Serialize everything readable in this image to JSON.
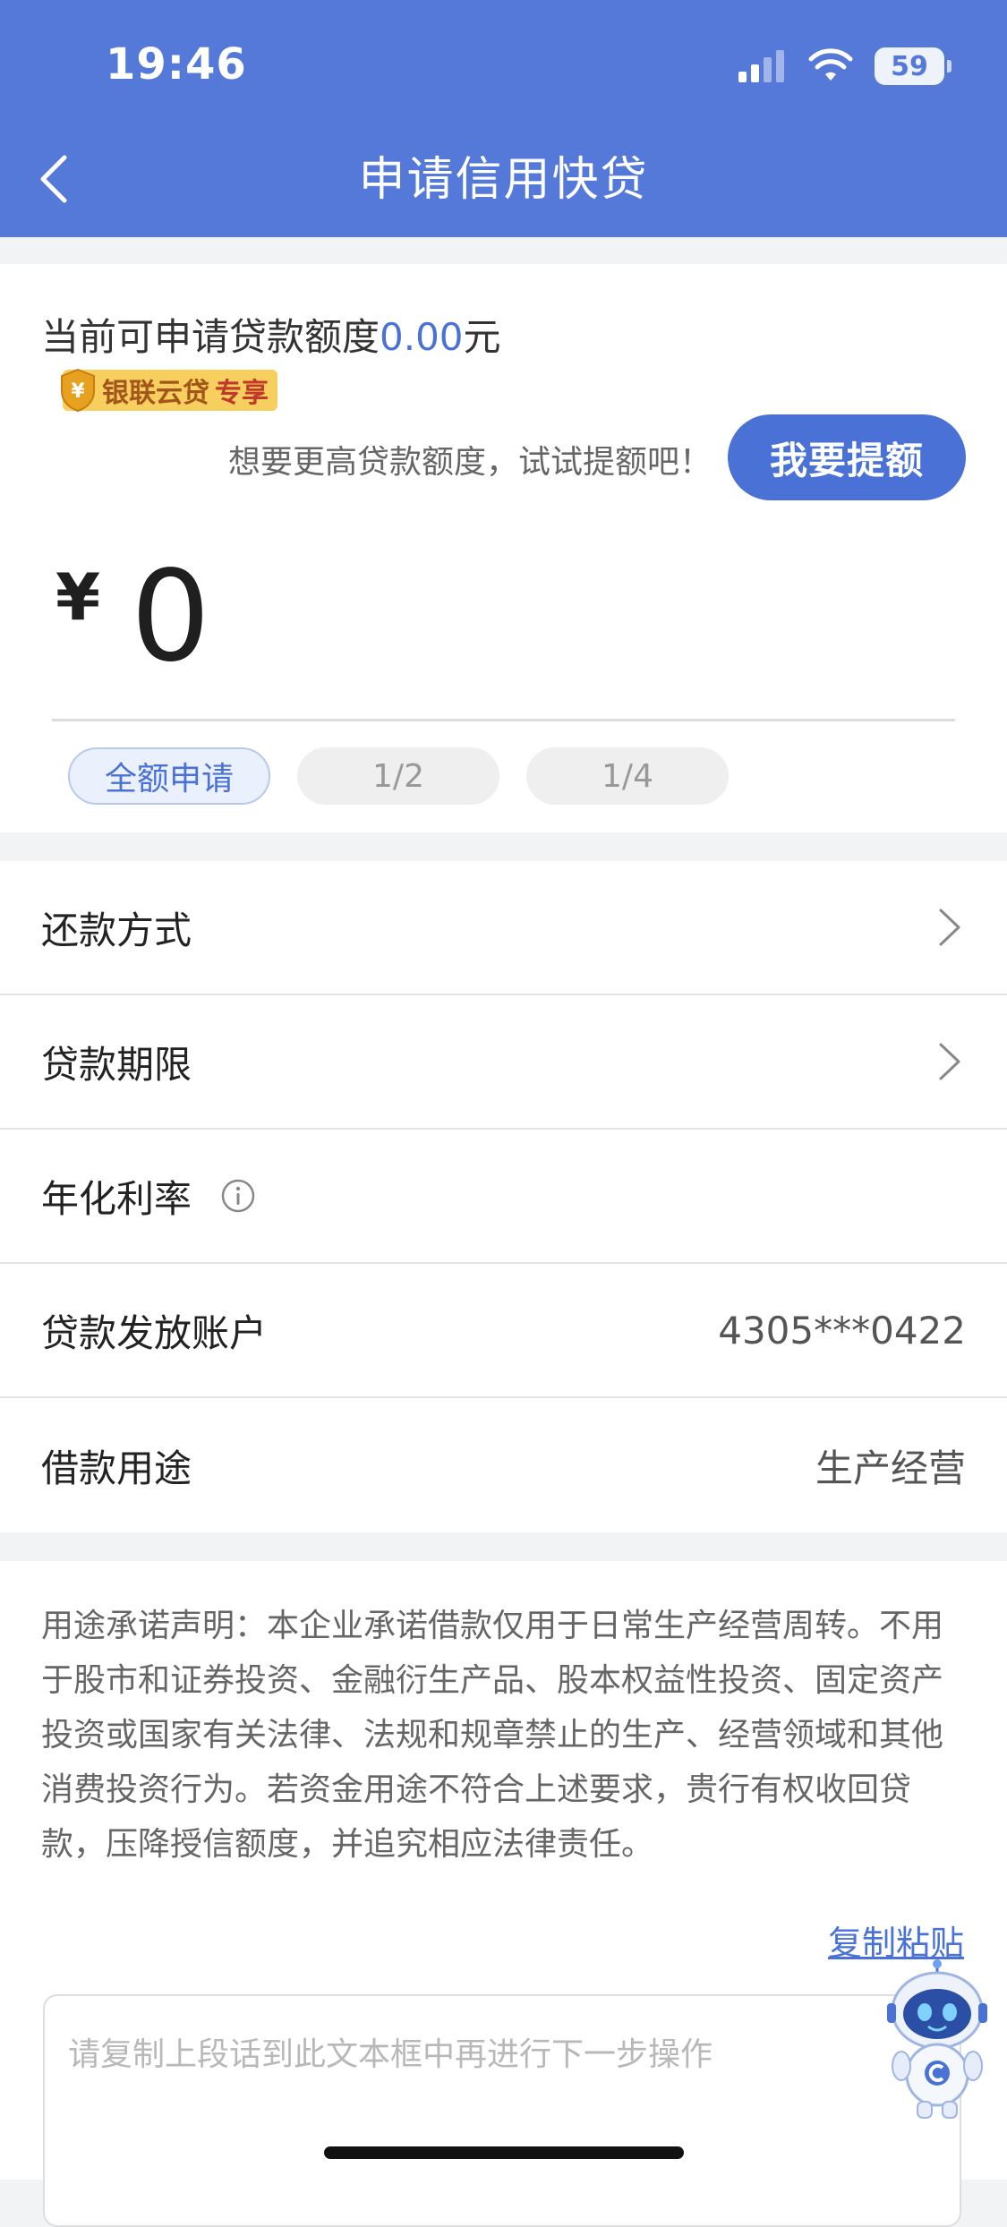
{
  "status_bar": {
    "time": "19:46",
    "battery": "59"
  },
  "nav": {
    "title": "申请信用快贷"
  },
  "quota": {
    "prefix": "当前可申请贷款额度",
    "amount": "0.00",
    "unit": "元",
    "badge_main": "银联云贷",
    "badge_sub": "专享",
    "hint": "想要更高贷款额度，试试提额吧！",
    "raise_button": "我要提额"
  },
  "amount": {
    "currency": "¥",
    "value": "0"
  },
  "chips": [
    "全额申请",
    "1/2",
    "1/4"
  ],
  "form": {
    "repayment_label": "还款方式",
    "term_label": "贷款期限",
    "rate_label": "年化利率",
    "account_label": "贷款发放账户",
    "account_value": "4305***0422",
    "purpose_label": "借款用途",
    "purpose_value": "生产经营"
  },
  "declaration": {
    "text": "用途承诺声明：本企业承诺借款仅用于日常生产经营周转。不用于股市和证券投资、金融衍生产品、股本权益性投资、固定资产投资或国家有关法律、法规和规章禁止的生产、经营领域和其他消费投资行为。若资金用途不符合上述要求，贵行有权收回贷款，压降授信额度，并追究相应法律责任。",
    "copy_link": "复制粘贴",
    "input_placeholder": "请复制上段话到此文本框中再进行下一步操作"
  },
  "colors": {
    "header": "#5479d8",
    "accent": "#4a72d6"
  },
  "icons": [
    "back-icon",
    "signal-icon",
    "wifi-icon",
    "battery-icon",
    "shield-icon",
    "chevron-right-icon",
    "info-icon",
    "robot-assistant-icon"
  ]
}
